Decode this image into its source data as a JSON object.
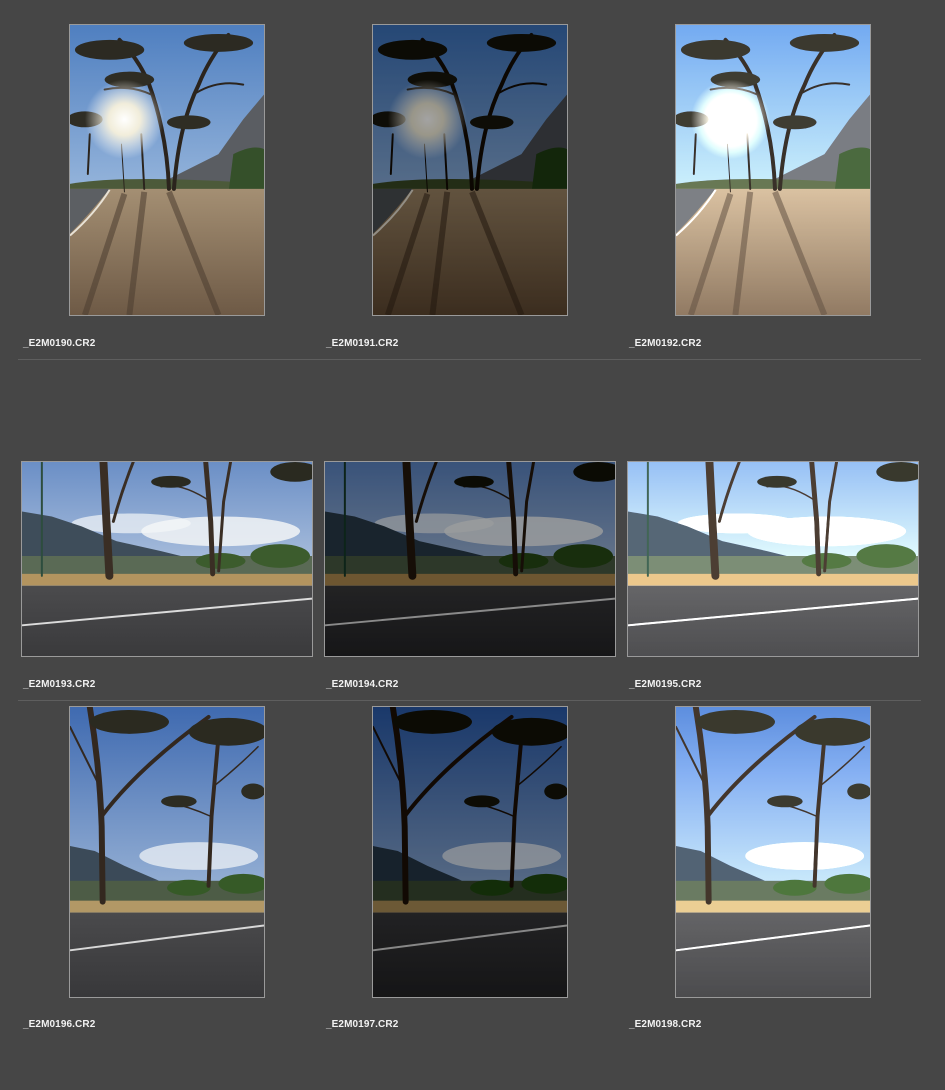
{
  "rows": [
    {
      "orientation": "portrait",
      "scene": "sun",
      "items": [
        {
          "filename": "_E2M0190.CR2",
          "tone": "normal"
        },
        {
          "filename": "_E2M0191.CR2",
          "tone": "dark"
        },
        {
          "filename": "_E2M0192.CR2",
          "tone": "bright"
        }
      ]
    },
    {
      "orientation": "landscape",
      "scene": "road",
      "items": [
        {
          "filename": "_E2M0193.CR2",
          "tone": "normal"
        },
        {
          "filename": "_E2M0194.CR2",
          "tone": "dark"
        },
        {
          "filename": "_E2M0195.CR2",
          "tone": "bright"
        }
      ]
    },
    {
      "orientation": "portrait",
      "scene": "trees",
      "items": [
        {
          "filename": "_E2M0196.CR2",
          "tone": "normal"
        },
        {
          "filename": "_E2M0197.CR2",
          "tone": "dark"
        },
        {
          "filename": "_E2M0198.CR2",
          "tone": "bright"
        }
      ]
    }
  ],
  "colors": {
    "background": "#464646",
    "thumb_border": "#9a9a9a",
    "label": "#f2f2f2",
    "divider": "#5e5e5e"
  }
}
